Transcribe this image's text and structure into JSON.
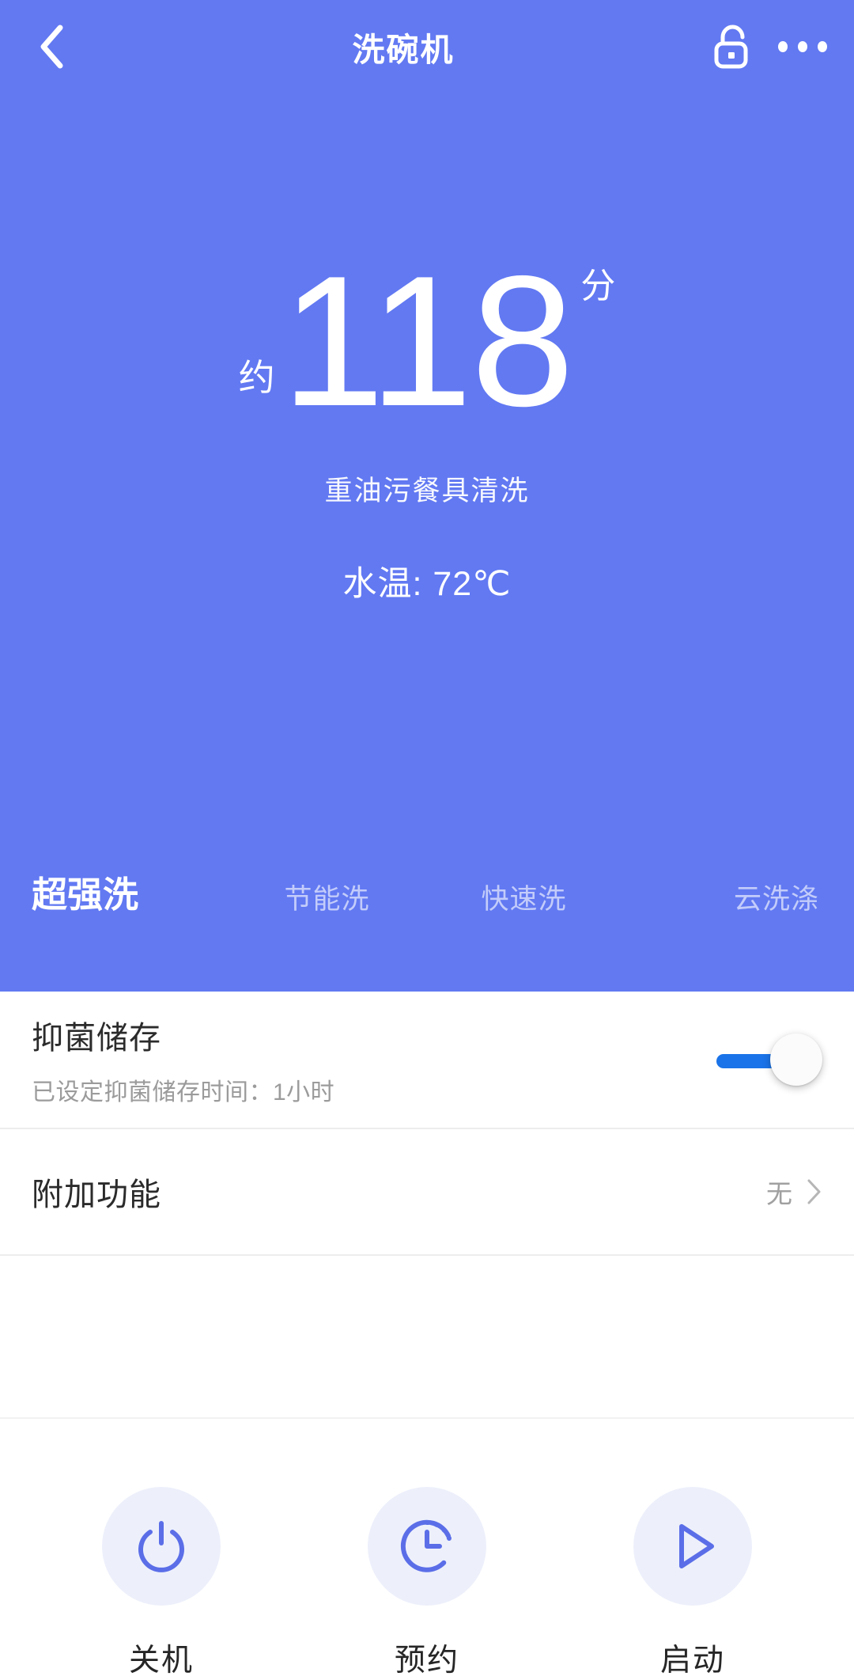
{
  "header": {
    "back_icon": "chevron-left-icon",
    "title": "洗碗机",
    "lock_icon": "unlock-icon",
    "menu_icon": "more-horizontal-icon"
  },
  "hero": {
    "approx_prefix": "约",
    "remaining_value": "118",
    "time_unit": "分",
    "program_name": "重油污餐具清洗",
    "water_temp": "水温: 72℃",
    "background_color": "#6279F2"
  },
  "tabs": [
    {
      "label": "超强洗",
      "active": true
    },
    {
      "label": "节能洗",
      "active": false
    },
    {
      "label": "快速洗",
      "active": false
    },
    {
      "label": "云洗涤",
      "active": false
    }
  ],
  "settings": {
    "sterilize_row": {
      "title": "抑菌储存",
      "subtitle": "已设定抑菌储存时间：1小时",
      "toggle_state": "on",
      "toggle_color": "#1A73E8"
    },
    "extra_row": {
      "title": "附加功能",
      "value": "无",
      "chevron_icon": "chevron-right-icon"
    }
  },
  "actions": [
    {
      "label": "关机",
      "icon": "power-icon"
    },
    {
      "label": "预约",
      "icon": "timer-clock-icon"
    },
    {
      "label": "启动",
      "icon": "play-icon"
    }
  ],
  "theme": {
    "accent_blue": "#5B6EE8",
    "action_circle_bg": "#EDF0FB"
  }
}
